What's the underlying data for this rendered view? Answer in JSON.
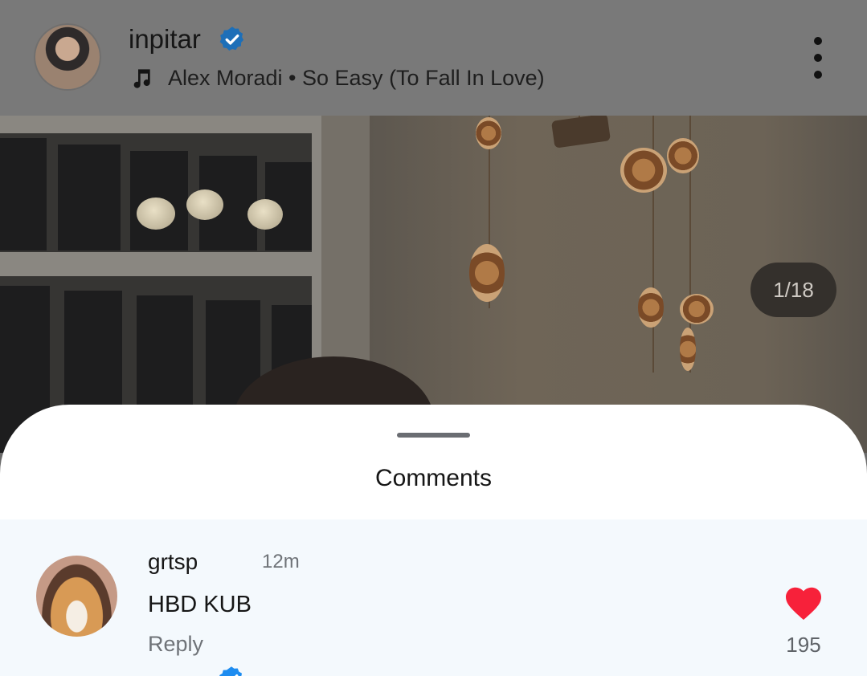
{
  "post": {
    "username": "inpitar",
    "verified": true,
    "music": "Alex Moradi • So Easy (To Fall In Love)",
    "icons": {
      "avatar": "profile-avatar",
      "verified": "verified-badge-icon",
      "music": "music-note-icon",
      "more": "more-vertical-icon"
    }
  },
  "photo": {
    "counter": "1/18"
  },
  "comments_sheet": {
    "title": "Comments",
    "comments": [
      {
        "username": "grtsp",
        "verified": true,
        "time": "12m",
        "text": "HBD KUB",
        "reply_label": "Reply",
        "likes": "195",
        "liked": true
      }
    ]
  },
  "colors": {
    "verified_blue": "#1d8cf0",
    "like_red": "#f7213a",
    "sheet_bg": "#ffffff",
    "comment_bg": "#f4f9fd"
  }
}
